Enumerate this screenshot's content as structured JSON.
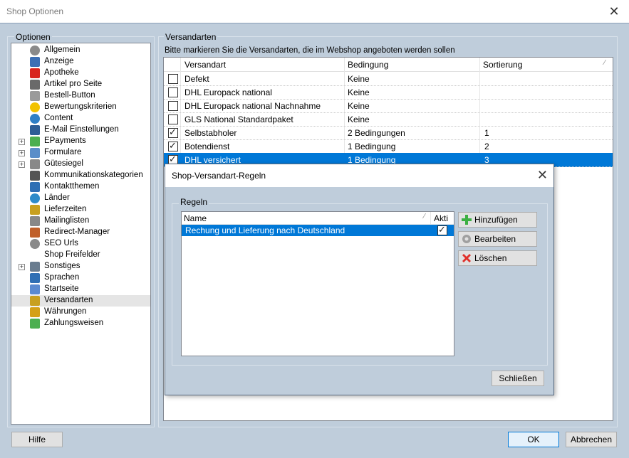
{
  "window": {
    "title": "Shop Optionen"
  },
  "options_group": {
    "label": "Optionen"
  },
  "tree": [
    {
      "label": "Allgemein",
      "icon": "gear-icon",
      "color": "#8a8a8a",
      "expandable": false
    },
    {
      "label": "Anzeige",
      "icon": "display-icon",
      "color": "#3c6fb4",
      "expandable": false
    },
    {
      "label": "Apotheke",
      "icon": "pharmacy-icon",
      "color": "#d8231c",
      "expandable": false
    },
    {
      "label": "Artikel pro Seite",
      "icon": "counter-icon",
      "color": "#6a6a6a",
      "expandable": false
    },
    {
      "label": "Bestell-Button",
      "icon": "basket-icon",
      "color": "#9a9a9a",
      "expandable": false
    },
    {
      "label": "Bewertungskriterien",
      "icon": "star-icon",
      "color": "#f2c200",
      "expandable": false
    },
    {
      "label": "Content",
      "icon": "globe-icon",
      "color": "#2f7fc6",
      "expandable": false
    },
    {
      "label": "E-Mail Einstellungen",
      "icon": "email-icon",
      "color": "#2e5e96",
      "expandable": false
    },
    {
      "label": "EPayments",
      "icon": "payment-icon",
      "color": "#4caf50",
      "expandable": true
    },
    {
      "label": "Formulare",
      "icon": "form-icon",
      "color": "#5b8ec9",
      "expandable": true
    },
    {
      "label": "Gütesiegel",
      "icon": "seal-icon",
      "color": "#888888",
      "expandable": true
    },
    {
      "label": "Kommunikationskategorien",
      "icon": "phone-icon",
      "color": "#555555",
      "expandable": false
    },
    {
      "label": "Kontaktthemen",
      "icon": "person-icon",
      "color": "#2f6fb4",
      "expandable": false
    },
    {
      "label": "Länder",
      "icon": "globe-icon",
      "color": "#2e8bc9",
      "expandable": false
    },
    {
      "label": "Lieferzeiten",
      "icon": "truck-icon",
      "color": "#c8a020",
      "expandable": false
    },
    {
      "label": "Mailinglisten",
      "icon": "list-icon",
      "color": "#888888",
      "expandable": false
    },
    {
      "label": "Redirect-Manager",
      "icon": "redirect-icon",
      "color": "#c0602a",
      "expandable": false
    },
    {
      "label": "SEO Urls",
      "icon": "gear-icon",
      "color": "#8a8a8a",
      "expandable": false
    },
    {
      "label": "Shop Freifelder",
      "icon": "blank-icon",
      "color": "#ffffff",
      "expandable": false
    },
    {
      "label": "Sonstiges",
      "icon": "wrench-icon",
      "color": "#6a7d90",
      "expandable": true
    },
    {
      "label": "Sprachen",
      "icon": "person-icon",
      "color": "#2f6fb4",
      "expandable": false
    },
    {
      "label": "Startseite",
      "icon": "home-icon",
      "color": "#5a8ad0",
      "expandable": false
    },
    {
      "label": "Versandarten",
      "icon": "truck-icon",
      "color": "#c8a020",
      "expandable": false,
      "selected": true
    },
    {
      "label": "Währungen",
      "icon": "euro-icon",
      "color": "#d4a017",
      "expandable": false
    },
    {
      "label": "Zahlungsweisen",
      "icon": "money-icon",
      "color": "#4caf50",
      "expandable": false
    }
  ],
  "shipping": {
    "group_label": "Versandarten",
    "instruction": "Bitte markieren Sie die Versandarten, die im Webshop angeboten werden sollen",
    "columns": [
      "Versandart",
      "Bedingung",
      "Sortierung"
    ],
    "rows": [
      {
        "checked": false,
        "name": "Defekt",
        "condition": "Keine",
        "sort": ""
      },
      {
        "checked": false,
        "name": "DHL Europack national",
        "condition": "Keine",
        "sort": ""
      },
      {
        "checked": false,
        "name": "DHL Europack national Nachnahme",
        "condition": "Keine",
        "sort": ""
      },
      {
        "checked": false,
        "name": "GLS National Standardpaket",
        "condition": "Keine",
        "sort": ""
      },
      {
        "checked": true,
        "name": "Selbstabholer",
        "condition": "2 Bedingungen",
        "sort": "1"
      },
      {
        "checked": true,
        "name": "Botendienst",
        "condition": "1 Bedingung",
        "sort": "2"
      },
      {
        "checked": true,
        "name": "DHL versichert",
        "condition": "1 Bedingung",
        "sort": "3",
        "selected": true
      }
    ]
  },
  "dialog": {
    "title": "Shop-Versandart-Regeln",
    "group_label": "Regeln",
    "columns": [
      "Name",
      "Akti"
    ],
    "rules": [
      {
        "name": "Rechung und Lieferung nach Deutschland",
        "active": true
      }
    ],
    "add_label": "Hinzufügen",
    "edit_label": "Bearbeiten",
    "delete_label": "Löschen",
    "close_label": "Schließen"
  },
  "footer": {
    "help_label": "Hilfe",
    "ok_label": "OK",
    "cancel_label": "Abbrechen"
  },
  "colors": {
    "accent": "#0078d7",
    "background": "#bfcddb"
  }
}
